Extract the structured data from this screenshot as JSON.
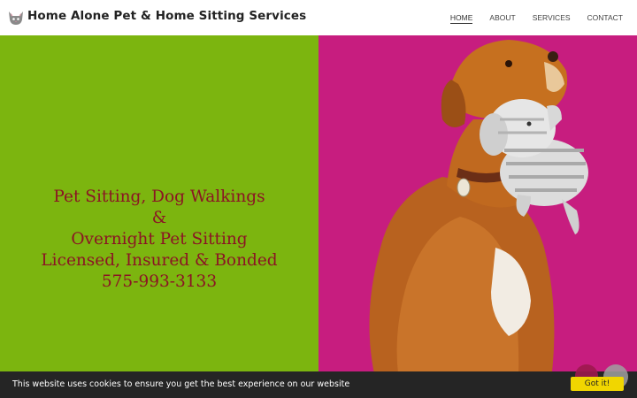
{
  "header": {
    "site_title": "Home Alone Pet & Home Sitting Services",
    "logo_icon": "cat-icon",
    "nav": [
      {
        "label": "HOME",
        "active": true
      },
      {
        "label": "ABOUT",
        "active": false
      },
      {
        "label": "SERVICES",
        "active": false
      },
      {
        "label": "CONTACT",
        "active": false
      }
    ]
  },
  "hero": {
    "lines": [
      "Pet Sitting, Dog Walkings",
      "&",
      "Overnight Pet Sitting",
      "Licensed, Insured & Bonded",
      "575-993-3133"
    ],
    "left_color": "#7cb50f",
    "right_color": "#c71d7f",
    "text_color": "#8b1424",
    "image_icon": "dog-with-toy-photo"
  },
  "cookie": {
    "message": "This website uses cookies to ensure you get the best experience on our website",
    "button_label": "Got it!",
    "button_color": "#f1d600"
  }
}
